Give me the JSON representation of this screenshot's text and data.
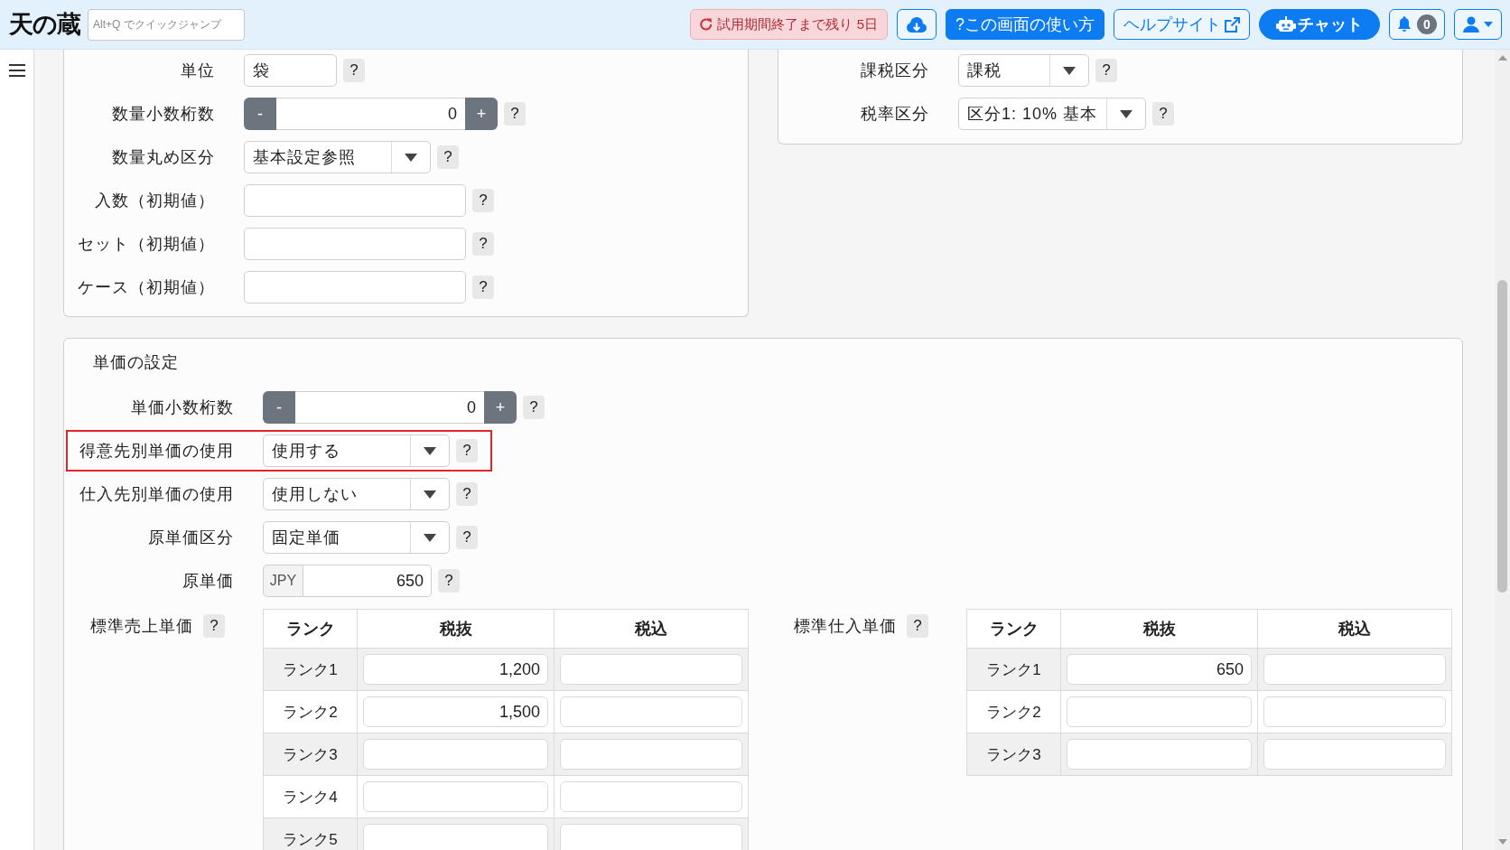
{
  "header": {
    "logo": "天の蔵",
    "search": {
      "placeholder": "Alt+Q でクイックジャンプ"
    },
    "trial_notice": "試用期間終了まで残り 5日",
    "buttons": [
      {
        "kind": "download"
      },
      {
        "kind": "guide",
        "label": "?この画面の使い方"
      },
      {
        "kind": "external",
        "label": "ヘルプサイト"
      },
      {
        "kind": "chat",
        "label": "チャット"
      },
      {
        "kind": "notifications",
        "count": "0"
      },
      {
        "kind": "account"
      }
    ]
  },
  "quantity_settings": {
    "fields": [
      {
        "label": "単位",
        "kind": "text",
        "value": "袋",
        "help": "?"
      },
      {
        "label": "数量小数桁数",
        "kind": "stepper",
        "decrement": "-",
        "value": "0",
        "increment": "+",
        "help": "?"
      },
      {
        "label": "数量丸め区分",
        "kind": "select",
        "value": "基本設定参照",
        "help": "?"
      },
      {
        "label": "入数（初期値）",
        "kind": "text",
        "help": "?"
      },
      {
        "label": "セット（初期値）",
        "kind": "text",
        "help": "?"
      },
      {
        "label": "ケース（初期値）",
        "kind": "text",
        "help": "?"
      }
    ]
  },
  "tax_settings": {
    "fields": [
      {
        "label": "課税区分",
        "kind": "select",
        "value": "課税",
        "help": "?"
      },
      {
        "label": "税率区分",
        "kind": "select",
        "value": "区分1: 10% 基本",
        "help": "?"
      }
    ]
  },
  "price_settings": {
    "title": "単価の設定",
    "fields": [
      {
        "label": "単価小数桁数",
        "kind": "stepper",
        "decrement": "-",
        "value": "0",
        "increment": "+",
        "help": "?",
        "highlighted": false
      },
      {
        "label": "得意先別単価の使用",
        "kind": "select",
        "value": "使用する",
        "help": "?",
        "highlighted": true
      },
      {
        "label": "仕入先別単価の使用",
        "kind": "select",
        "value": "使用しない",
        "help": "?",
        "highlighted": false
      },
      {
        "label": "原単価区分",
        "kind": "select",
        "value": "固定単価",
        "help": "?",
        "highlighted": false
      },
      {
        "label": "原単価",
        "kind": "currency",
        "currency": "JPY",
        "value": "650",
        "help": "?",
        "highlighted": false
      }
    ],
    "price_tables": [
      {
        "label": "標準売上単価",
        "help": "?",
        "columns": [
          "ランク",
          "税抜",
          "税込"
        ],
        "rows": [
          {
            "rank": "ランク1",
            "excluding_tax": "1,200"
          },
          {
            "rank": "ランク2",
            "excluding_tax": "1,500"
          },
          {
            "rank": "ランク3"
          },
          {
            "rank": "ランク4"
          },
          {
            "rank": "ランク5"
          }
        ]
      },
      {
        "label": "標準仕入単価",
        "help": "?",
        "columns": [
          "ランク",
          "税抜",
          "税込"
        ],
        "rows": [
          {
            "rank": "ランク1",
            "excluding_tax": "650"
          },
          {
            "rank": "ランク2"
          },
          {
            "rank": "ランク3"
          }
        ]
      }
    ]
  }
}
